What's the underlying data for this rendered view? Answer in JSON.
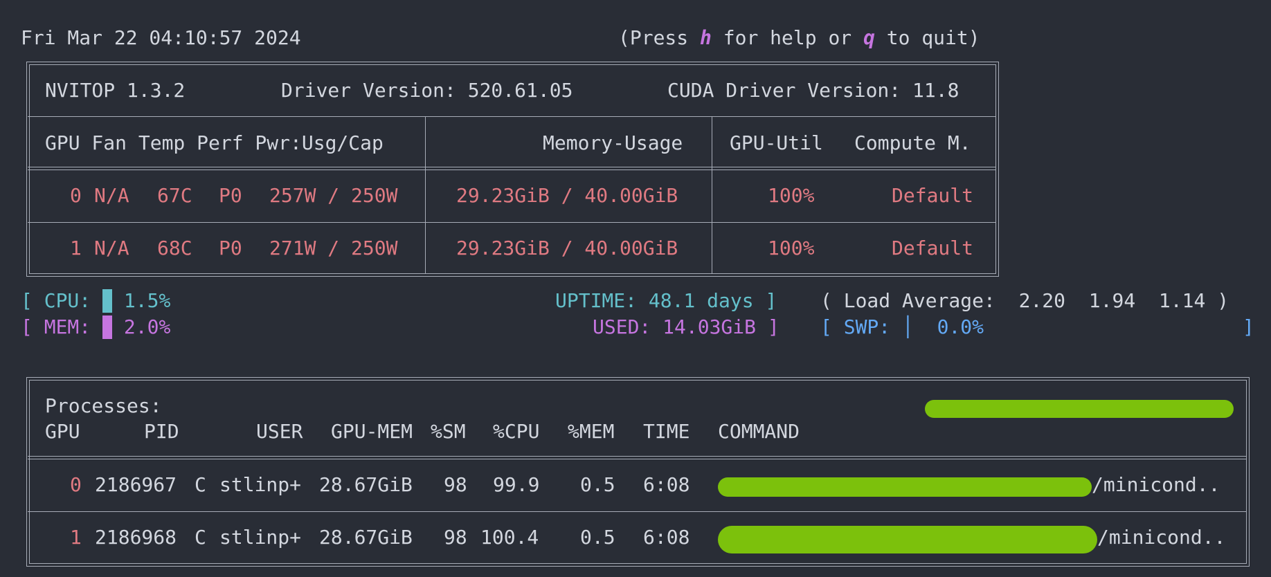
{
  "header": {
    "datetime": "Fri Mar 22 04:10:57 2024",
    "help_prefix": "(Press ",
    "help_key": "h",
    "help_middle": " for help or ",
    "quit_key": "q",
    "help_suffix": " to quit)"
  },
  "device_panel": {
    "app_version": "NVITOP 1.3.2",
    "driver_version": "Driver Version: 520.61.05",
    "cuda_version": "CUDA Driver Version: 11.8",
    "columns": {
      "left": "GPU Fan Temp Perf Pwr:Usg/Cap",
      "memory": "Memory-Usage",
      "util": "GPU-Util",
      "compute": "Compute M."
    },
    "gpus": [
      {
        "index": "0",
        "fan": "N/A",
        "temp": "67C",
        "perf": "P0",
        "power": "257W / 250W",
        "memory": "29.23GiB / 40.00GiB",
        "util": "100%",
        "compute": "Default"
      },
      {
        "index": "1",
        "fan": "N/A",
        "temp": "68C",
        "perf": "P0",
        "power": "271W / 250W",
        "memory": "29.23GiB / 40.00GiB",
        "util": "100%",
        "compute": "Default"
      }
    ]
  },
  "host": {
    "cpu_label": "CPU:",
    "cpu_percent": "1.5%",
    "cpu_fraction": 0.015,
    "mem_label": "MEM:",
    "mem_percent": "2.0%",
    "mem_fraction": 0.02,
    "uptime": "UPTIME: 48.1 days",
    "used": "USED: 14.03GiB",
    "load_label": "Load Average:",
    "load_1": "2.20",
    "load_5": "1.94",
    "load_15": "1.14",
    "swp_label": "SWP:",
    "swp_percent": "0.0%",
    "open_bracket": "[",
    "close_bracket": "]",
    "open_paren": "(",
    "close_paren": ")",
    "colors": {
      "cpu": "#64c0cb",
      "mem": "#c675e0",
      "swp": "#63a9f5"
    }
  },
  "processes": {
    "title": "Processes:",
    "columns": {
      "gpu": "GPU",
      "pid": "PID",
      "user": "USER",
      "gpu_mem": "GPU-MEM",
      "sm": "%SM",
      "cpu": "%CPU",
      "mem": "%MEM",
      "time": "TIME",
      "command": "COMMAND"
    },
    "rows": [
      {
        "gpu": "0",
        "pid": "2186967",
        "type": "C",
        "user": "stlinp+",
        "gpu_mem": "28.67GiB",
        "sm": "98",
        "cpu": "99.9",
        "mem": "0.5",
        "time": "6:08",
        "command": "/minicond.."
      },
      {
        "gpu": "1",
        "pid": "2186968",
        "type": "C",
        "user": "stlinp+",
        "gpu_mem": "28.67GiB",
        "sm": "98",
        "cpu": "100.4",
        "mem": "0.5",
        "time": "6:08",
        "command": "/minicond.."
      }
    ]
  }
}
